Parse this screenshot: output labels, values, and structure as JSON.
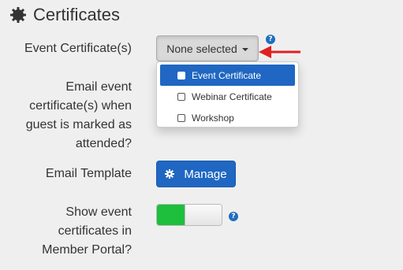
{
  "section": {
    "title": "Certificates",
    "icon": "gear-icon"
  },
  "fields": {
    "event_certificates": {
      "label": "Event Certificate(s)",
      "selected": "None selected",
      "options": [
        {
          "label": "Event Certificate",
          "checked": false,
          "highlighted": true
        },
        {
          "label": "Webinar Certificate",
          "checked": false,
          "highlighted": false
        },
        {
          "label": "Workshop",
          "checked": false,
          "highlighted": false
        }
      ]
    },
    "email_when_attended": {
      "label_lines": [
        "Email event",
        "certificate(s) when",
        "guest is marked as",
        "attended?"
      ]
    },
    "email_template": {
      "label": "Email Template",
      "button": "Manage"
    },
    "show_in_portal": {
      "label_lines": [
        "Show event",
        "certificates in",
        "Member Portal?"
      ],
      "enabled": true
    }
  },
  "help_glyph": "?",
  "colors": {
    "primary": "#1f67c2",
    "toggle_on": "#1dbf3c",
    "annotation_arrow": "#e02020"
  }
}
